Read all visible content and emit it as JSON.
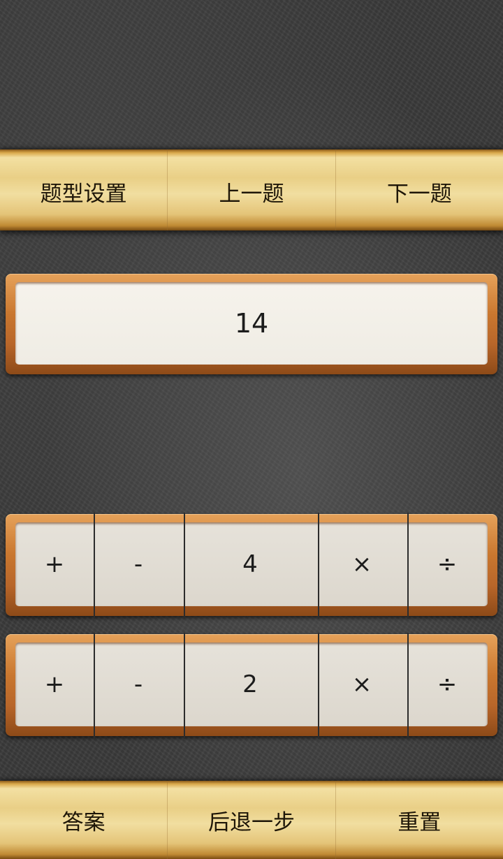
{
  "toolbar": {
    "settings_label": "题型设置",
    "prev_label": "上一题",
    "next_label": "下一题"
  },
  "display": {
    "target": "14"
  },
  "rows": [
    {
      "plus": "+",
      "minus": "-",
      "value": "4",
      "times": "×",
      "divide": "÷"
    },
    {
      "plus": "+",
      "minus": "-",
      "value": "2",
      "times": "×",
      "divide": "÷"
    }
  ],
  "footer": {
    "answer_label": "答案",
    "undo_label": "后退一步",
    "reset_label": "重置"
  }
}
